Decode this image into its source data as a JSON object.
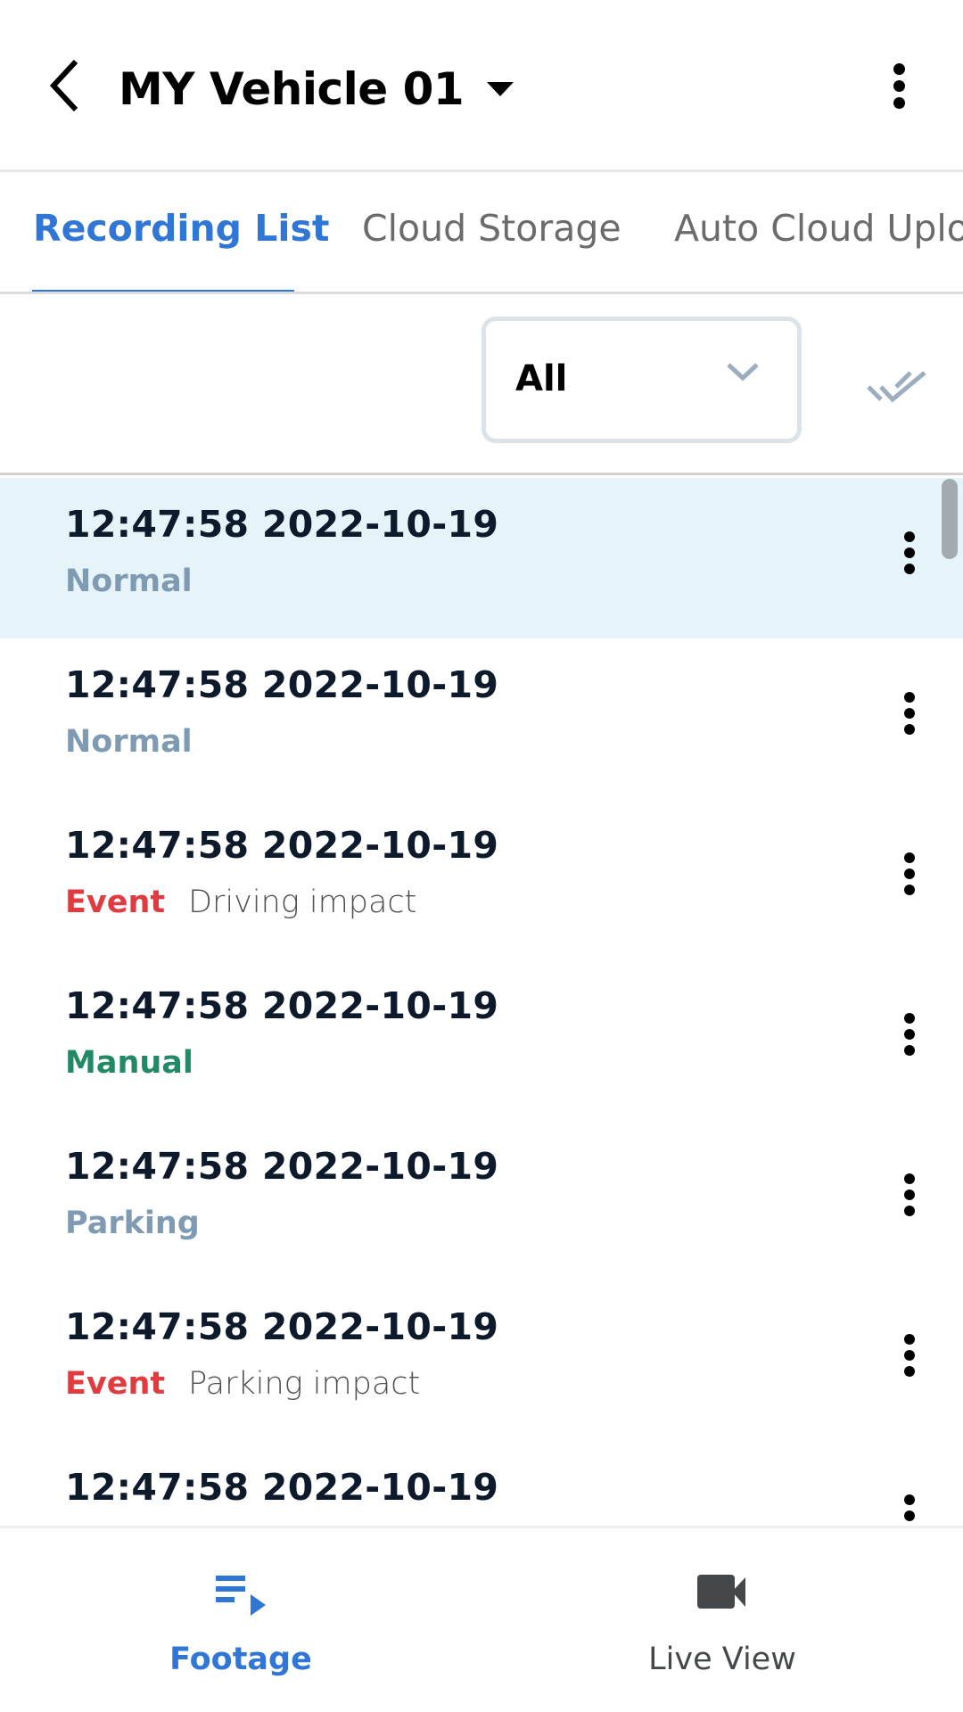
{
  "header": {
    "title": "MY Vehicle 01",
    "back_icon": "chevron-left-icon",
    "caret_icon": "caret-down-icon",
    "menu_icon": "more-vertical-icon"
  },
  "tabs": [
    {
      "label": "Recording List",
      "active": true
    },
    {
      "label": "Cloud Storage",
      "active": false
    },
    {
      "label": "Auto Cloud Uplo",
      "active": false
    }
  ],
  "filter": {
    "selected": "All",
    "chevron_icon": "chevron-down-icon",
    "select_all_icon": "double-check-icon"
  },
  "colors": {
    "accent": "#2f76d6",
    "normal": "#7f9bb3",
    "event": "#e03c40",
    "manual": "#218a64",
    "parking": "#7f9bb3",
    "selected_row": "#e6f4fa"
  },
  "recordings": [
    {
      "time": "12:47:58 2022-10-19",
      "type": "Normal",
      "type_key": "normal",
      "detail": "",
      "selected": true
    },
    {
      "time": "12:47:58 2022-10-19",
      "type": "Normal",
      "type_key": "normal",
      "detail": "",
      "selected": false
    },
    {
      "time": "12:47:58 2022-10-19",
      "type": "Event",
      "type_key": "event",
      "detail": "Driving impact",
      "selected": false
    },
    {
      "time": "12:47:58 2022-10-19",
      "type": "Manual",
      "type_key": "manual",
      "detail": "",
      "selected": false
    },
    {
      "time": "12:47:58 2022-10-19",
      "type": "Parking",
      "type_key": "parking",
      "detail": "",
      "selected": false
    },
    {
      "time": "12:47:58 2022-10-19",
      "type": "Event",
      "type_key": "event",
      "detail": "Parking impact",
      "selected": false
    },
    {
      "time": "12:47:58 2022-10-19",
      "type": "",
      "type_key": "normal",
      "detail": "",
      "selected": false
    }
  ],
  "bottom_nav": [
    {
      "label": "Footage",
      "icon": "playlist-play-icon",
      "active": true
    },
    {
      "label": "Live View",
      "icon": "videocam-icon",
      "active": false
    }
  ]
}
